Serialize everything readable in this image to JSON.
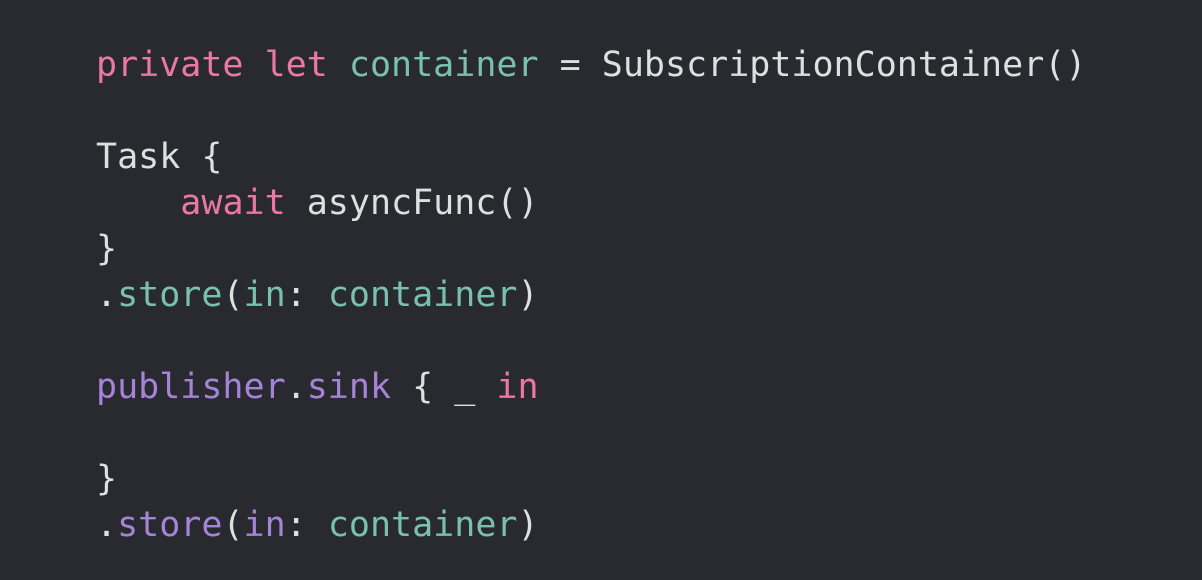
{
  "colors": {
    "background": "#292a2f",
    "keyword": "#ea78a3",
    "property": "#79c0b2",
    "method": "#a583d6",
    "plain": "#dfdfe0"
  },
  "code_lines": [
    [
      {
        "text": "private",
        "kind": "keyword"
      },
      {
        "text": " ",
        "kind": "plain"
      },
      {
        "text": "let",
        "kind": "keyword"
      },
      {
        "text": " ",
        "kind": "plain"
      },
      {
        "text": "container",
        "kind": "property"
      },
      {
        "text": " = SubscriptionContainer()",
        "kind": "plain"
      }
    ],
    [],
    [
      {
        "text": "Task {",
        "kind": "plain"
      }
    ],
    [
      {
        "text": "    ",
        "kind": "plain"
      },
      {
        "text": "await",
        "kind": "keyword"
      },
      {
        "text": " asyncFunc()",
        "kind": "plain"
      }
    ],
    [
      {
        "text": "}",
        "kind": "plain"
      }
    ],
    [
      {
        "text": ".",
        "kind": "plain"
      },
      {
        "text": "store",
        "kind": "property"
      },
      {
        "text": "(",
        "kind": "plain"
      },
      {
        "text": "in",
        "kind": "property"
      },
      {
        "text": ": ",
        "kind": "plain"
      },
      {
        "text": "container",
        "kind": "property"
      },
      {
        "text": ")",
        "kind": "plain"
      }
    ],
    [],
    [
      {
        "text": "publisher",
        "kind": "method"
      },
      {
        "text": ".",
        "kind": "plain"
      },
      {
        "text": "sink",
        "kind": "method"
      },
      {
        "text": " { _ ",
        "kind": "plain"
      },
      {
        "text": "in",
        "kind": "keyword"
      }
    ],
    [],
    [
      {
        "text": "}",
        "kind": "plain"
      }
    ],
    [
      {
        "text": ".",
        "kind": "plain"
      },
      {
        "text": "store",
        "kind": "method"
      },
      {
        "text": "(",
        "kind": "plain"
      },
      {
        "text": "in",
        "kind": "method"
      },
      {
        "text": ": ",
        "kind": "plain"
      },
      {
        "text": "container",
        "kind": "property"
      },
      {
        "text": ")",
        "kind": "plain"
      }
    ]
  ]
}
